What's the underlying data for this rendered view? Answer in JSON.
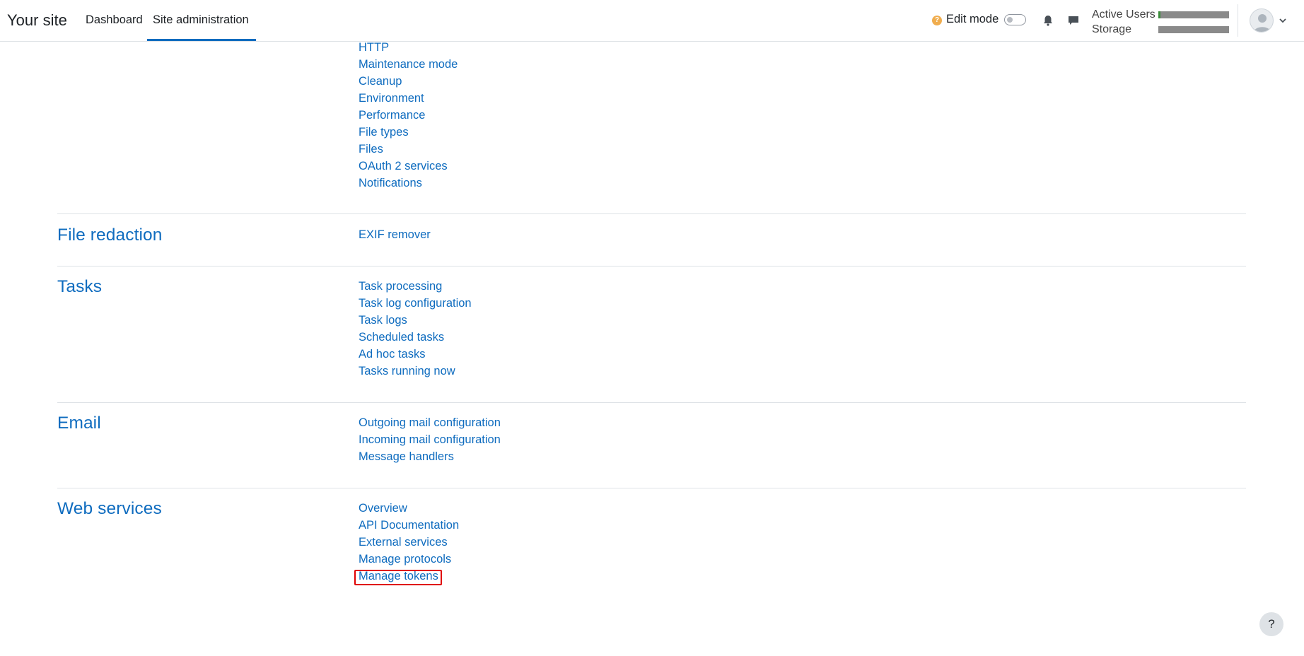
{
  "navbar": {
    "brand": "Your site",
    "links": [
      "Dashboard",
      "Site administration"
    ],
    "active_link": "Site administration",
    "edit_mode_label": "Edit mode",
    "edit_mode_on": false,
    "usage": [
      {
        "label": "Active Users",
        "fill_fraction": 0.03
      },
      {
        "label": "Storage",
        "fill_fraction": 0.0
      }
    ],
    "icons": [
      "help-icon",
      "bell-icon",
      "chat-icon",
      "avatar",
      "chevron-down-icon"
    ]
  },
  "sections": {
    "server_links": [
      "HTTP",
      "Maintenance mode",
      "Cleanup",
      "Environment",
      "Performance",
      "File types",
      "Files",
      "OAuth 2 services",
      "Notifications"
    ],
    "file_redaction": {
      "title": "File redaction",
      "links": [
        "EXIF remover"
      ]
    },
    "tasks": {
      "title": "Tasks",
      "links": [
        "Task processing",
        "Task log configuration",
        "Task logs",
        "Scheduled tasks",
        "Ad hoc tasks",
        "Tasks running now"
      ]
    },
    "email": {
      "title": "Email",
      "links": [
        "Outgoing mail configuration",
        "Incoming mail configuration",
        "Message handlers"
      ]
    },
    "web_services": {
      "title": "Web services",
      "links": [
        "Overview",
        "API Documentation",
        "External services",
        "Manage protocols",
        "Manage tokens"
      ]
    }
  },
  "highlighted_link": "Manage tokens",
  "footer": {
    "help_label": "?"
  },
  "colors": {
    "link": "#0f6cbf",
    "highlight": "#e00000",
    "accent": "#0f6cbf"
  }
}
